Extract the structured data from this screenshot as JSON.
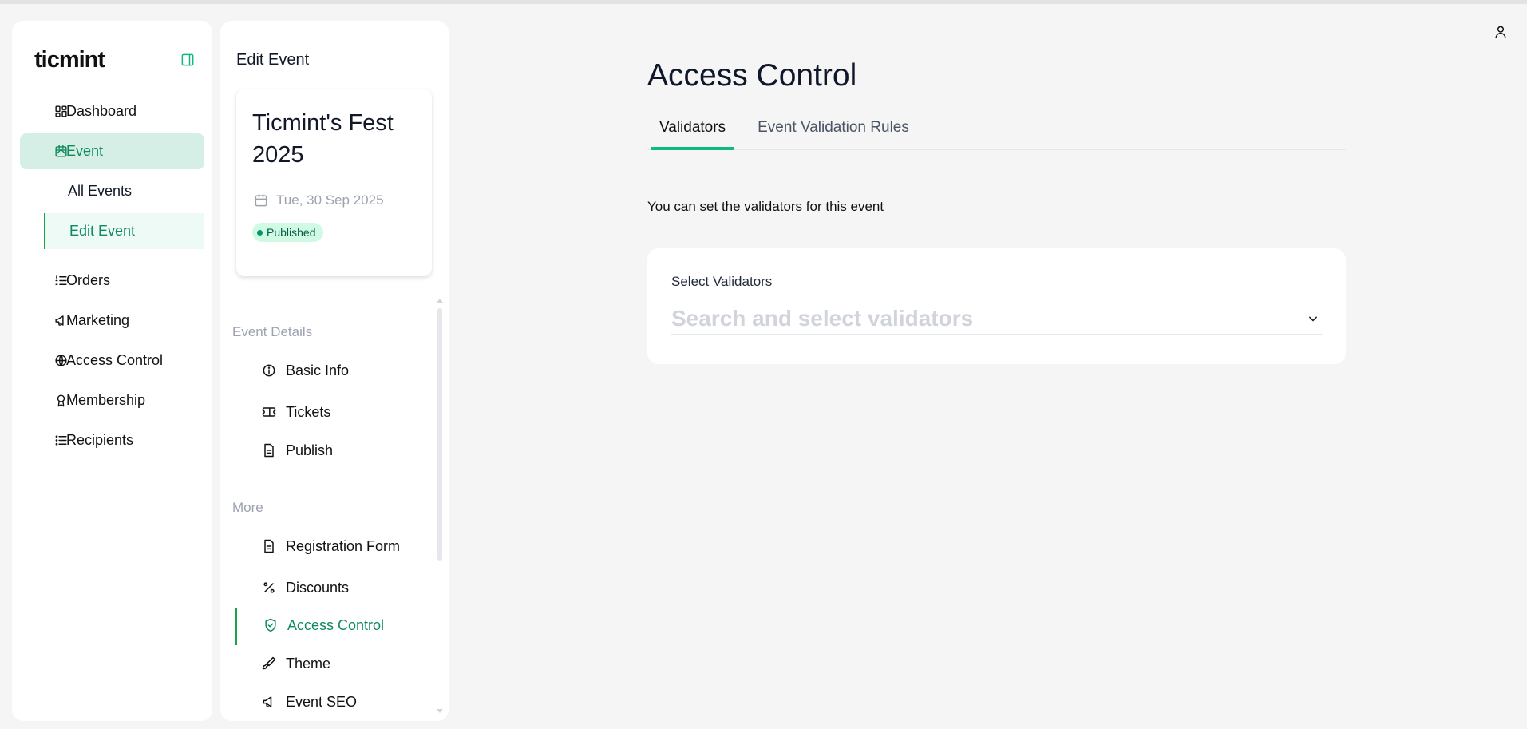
{
  "app": {
    "logo": "ticmint"
  },
  "sidebar": {
    "items": [
      {
        "label": "Dashboard"
      },
      {
        "label": "Event"
      },
      {
        "label": "Orders"
      },
      {
        "label": "Marketing"
      },
      {
        "label": "Access Control"
      },
      {
        "label": "Membership"
      },
      {
        "label": "Recipients"
      }
    ],
    "event_sub": [
      {
        "label": "All Events"
      },
      {
        "label": "Edit Event"
      }
    ]
  },
  "panel": {
    "title": "Edit Event",
    "event": {
      "name": "Ticmint's Fest 2025",
      "date": "Tue, 30 Sep 2025",
      "status": "Published"
    },
    "sections": {
      "details": "Event Details",
      "more": "More"
    },
    "details_items": [
      {
        "label": "Basic Info"
      },
      {
        "label": "Tickets"
      },
      {
        "label": "Publish"
      }
    ],
    "more_items": [
      {
        "label": "Registration Form"
      },
      {
        "label": "Discounts"
      },
      {
        "label": "Access Control"
      },
      {
        "label": "Theme"
      },
      {
        "label": "Event SEO"
      }
    ]
  },
  "main": {
    "title": "Access Control",
    "tabs": [
      {
        "label": "Validators"
      },
      {
        "label": "Event Validation Rules"
      }
    ],
    "description": "You can set the validators for this event",
    "validators": {
      "label": "Select Validators",
      "placeholder": "Search and select validators"
    }
  },
  "colors": {
    "accent": "#10b981",
    "active_bg": "#d6efe6",
    "active_text": "#0f8a5c"
  }
}
